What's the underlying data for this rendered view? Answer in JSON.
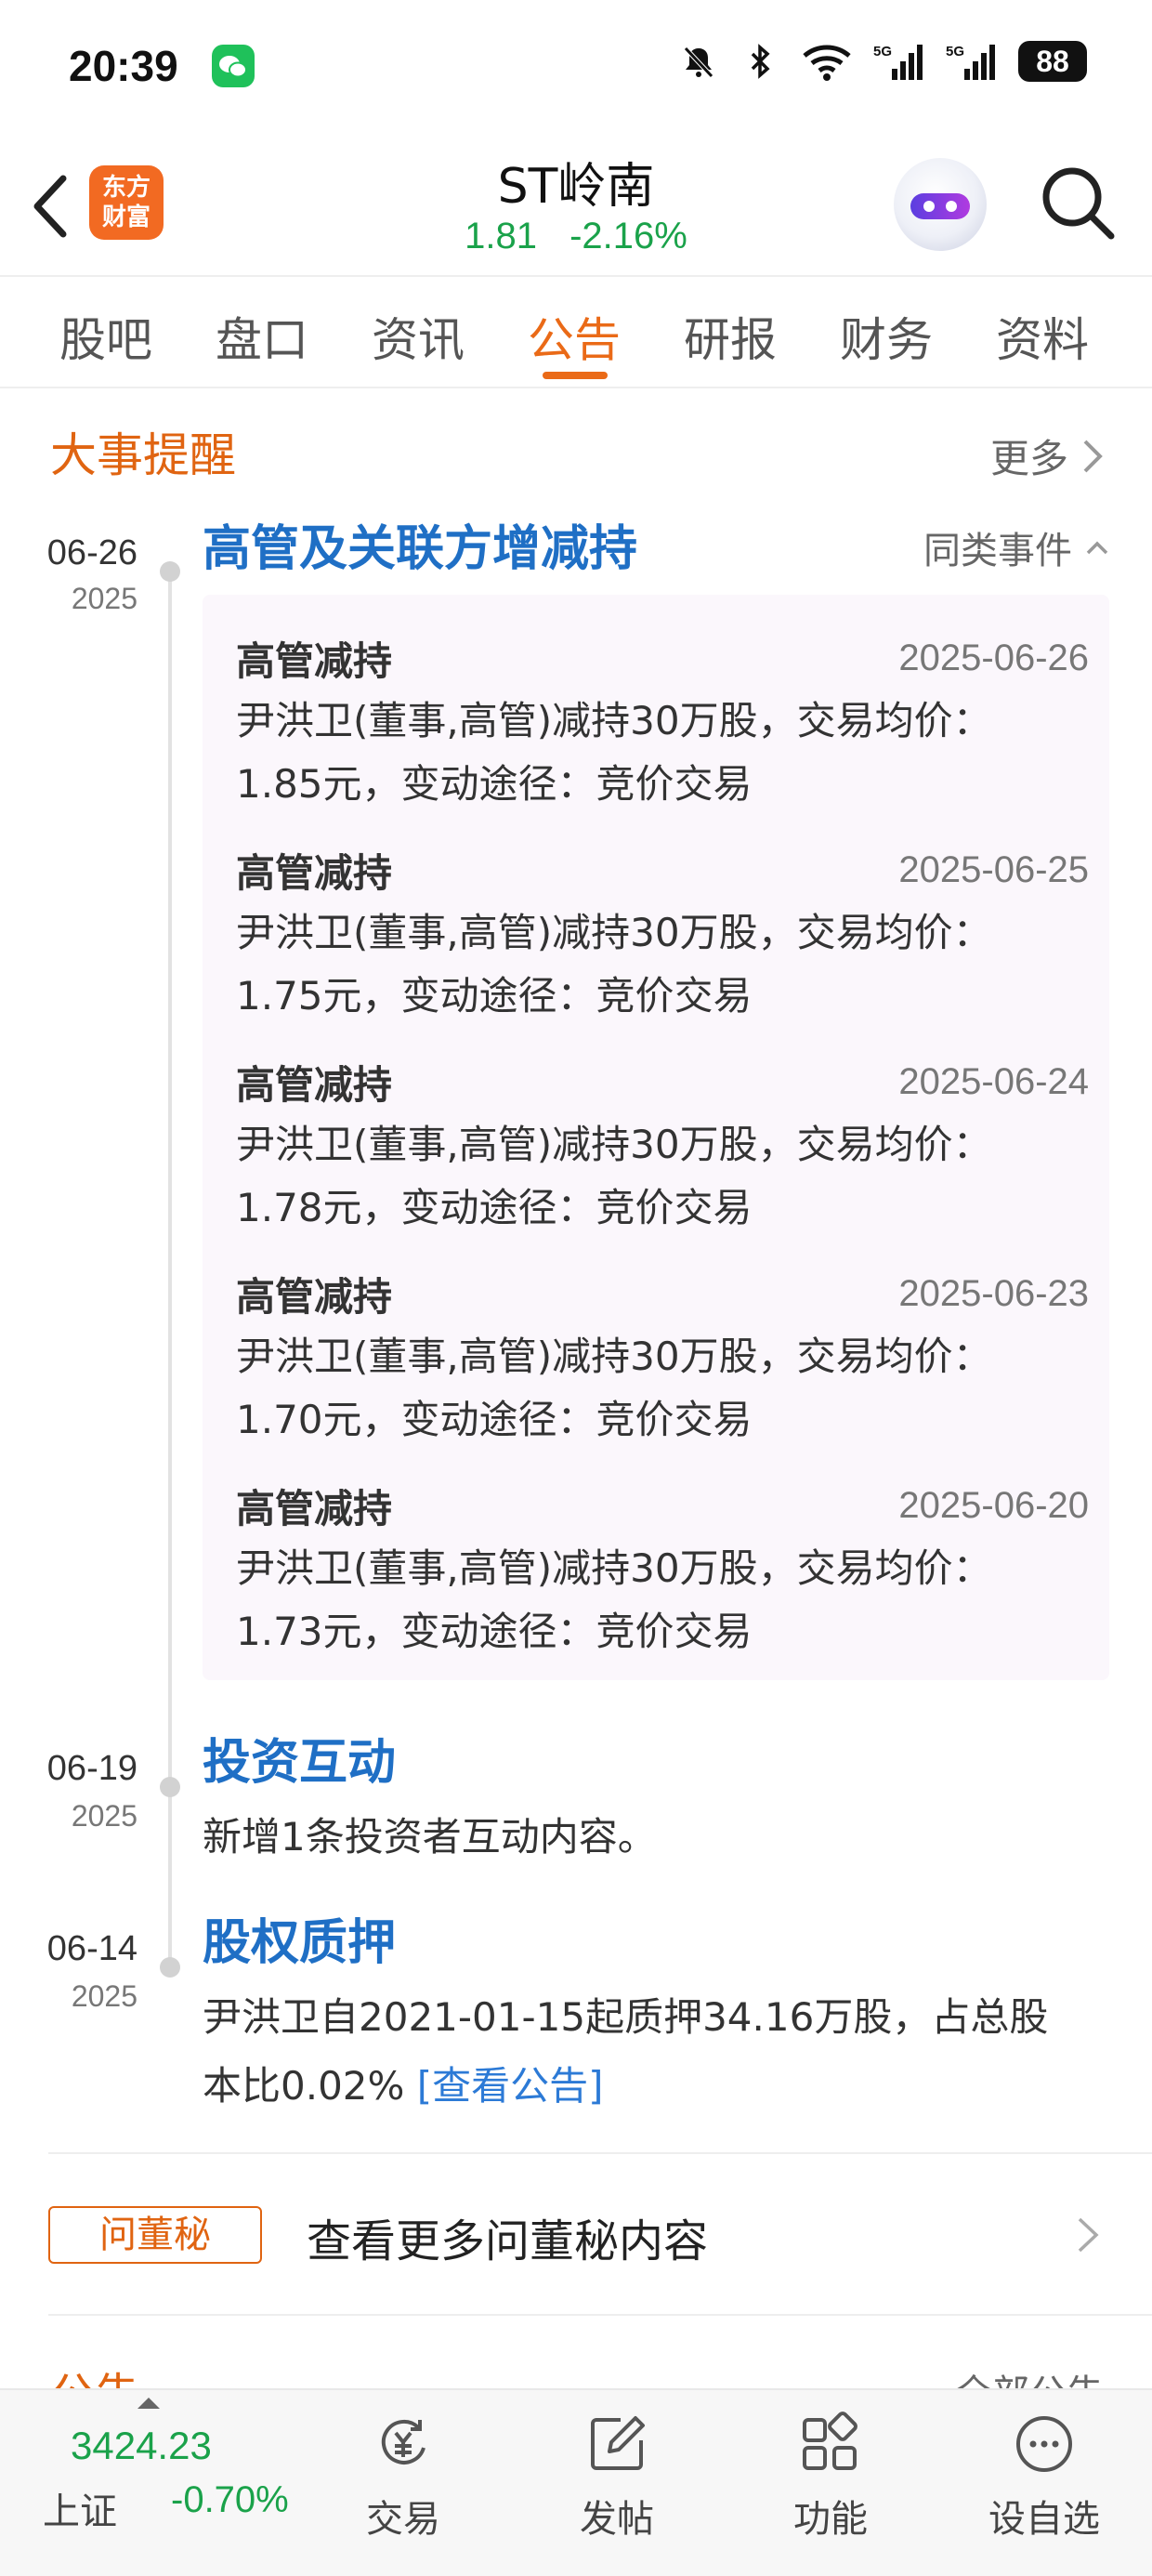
{
  "status_bar": {
    "time": "20:39",
    "battery": "88",
    "icons": [
      "wechat-icon",
      "mute-icon",
      "bluetooth-icon",
      "wifi-icon",
      "5g-signal-icon",
      "5g-signal-icon",
      "battery-icon"
    ]
  },
  "header": {
    "logo_text_1": "东方",
    "logo_text_2": "财富",
    "stock_name": "ST岭南",
    "price": "1.81",
    "change_pct": "-2.16%"
  },
  "tabs": [
    "股吧",
    "盘口",
    "资讯",
    "公告",
    "研报",
    "财务",
    "资料"
  ],
  "active_tab": "公告",
  "section": {
    "title": "大事提醒",
    "more_label": "更多"
  },
  "events": [
    {
      "date": "06-26",
      "year": "2025",
      "title": "高管及关联方增减持",
      "similar_label": "同类事件",
      "items": [
        {
          "title": "高管减持",
          "date": "2025-06-26",
          "line1": "尹洪卫(董事,高管)减持30万股，交易均价：",
          "line2": "1.85元，变动途径：竞价交易"
        },
        {
          "title": "高管减持",
          "date": "2025-06-25",
          "line1": "尹洪卫(董事,高管)减持30万股，交易均价：",
          "line2": "1.75元，变动途径：竞价交易"
        },
        {
          "title": "高管减持",
          "date": "2025-06-24",
          "line1": "尹洪卫(董事,高管)减持30万股，交易均价：",
          "line2": "1.78元，变动途径：竞价交易"
        },
        {
          "title": "高管减持",
          "date": "2025-06-23",
          "line1": "尹洪卫(董事,高管)减持30万股，交易均价：",
          "line2": "1.70元，变动途径：竞价交易"
        },
        {
          "title": "高管减持",
          "date": "2025-06-20",
          "line1": "尹洪卫(董事,高管)减持30万股，交易均价：",
          "line2": "1.73元，变动途径：竞价交易"
        }
      ]
    },
    {
      "date": "06-19",
      "year": "2025",
      "title": "投资互动",
      "text": "新增1条投资者互动内容。"
    },
    {
      "date": "06-14",
      "year": "2025",
      "title": "股权质押",
      "text_line1": "尹洪卫自2021-01-15起质押34.16万股，占总股",
      "text_line2": "本比0.02%",
      "link_label": "[查看公告]"
    }
  ],
  "secretary": {
    "badge": "问董秘",
    "text": "查看更多问董秘内容"
  },
  "next_section": {
    "title": "公告",
    "more_label": "全部公告"
  },
  "bottom_bar": {
    "index_value": "3424.23",
    "index_name": "上证",
    "index_change": "-0.70%",
    "nav": [
      {
        "label": "交易",
        "icon": "yuan-exchange-icon"
      },
      {
        "label": "发帖",
        "icon": "edit-icon"
      },
      {
        "label": "功能",
        "icon": "grid-apps-icon"
      },
      {
        "label": "设自选",
        "icon": "more-dots-icon"
      }
    ]
  },
  "colors": {
    "accent_orange": "#ea6a17",
    "link_blue": "#1f6fc5",
    "quote_green": "#1aa24a"
  }
}
